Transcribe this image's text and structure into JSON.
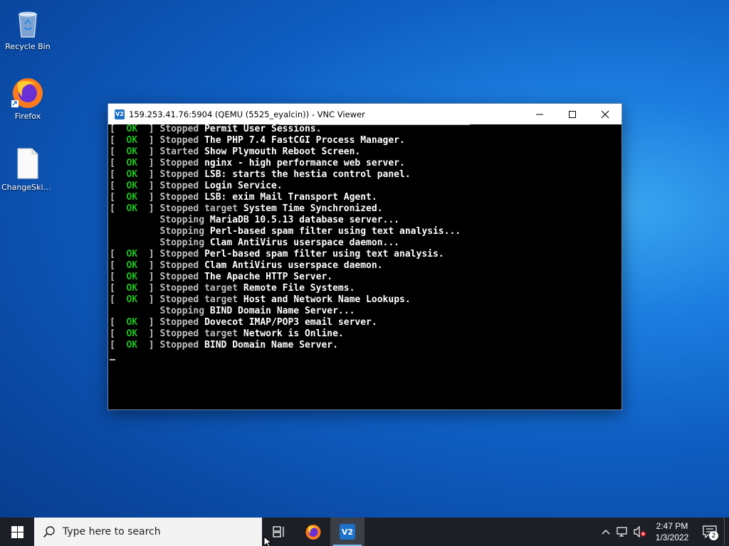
{
  "desktop": {
    "icons": [
      {
        "label": "Recycle Bin",
        "icon": "recycle-bin-icon"
      },
      {
        "label": "Firefox",
        "icon": "firefox-icon"
      },
      {
        "label": "ChangeSkin...",
        "icon": "file-icon"
      }
    ]
  },
  "window": {
    "title": "159.253.41.76:5904 (QEMU (5525_eyalcin)) - VNC Viewer",
    "logo_text": "V2"
  },
  "terminal": {
    "lines": [
      {
        "ok": true,
        "verb": "Stopped",
        "target": false,
        "text": "Permit User Sessions."
      },
      {
        "ok": true,
        "verb": "Stopped",
        "target": false,
        "text": "The PHP 7.4 FastCGI Process Manager."
      },
      {
        "ok": true,
        "verb": "Started",
        "target": false,
        "text": "Show Plymouth Reboot Screen."
      },
      {
        "ok": true,
        "verb": "Stopped",
        "target": false,
        "text": "nginx - high performance web server."
      },
      {
        "ok": true,
        "verb": "Stopped",
        "target": false,
        "text": "LSB: starts the hestia control panel."
      },
      {
        "ok": true,
        "verb": "Stopped",
        "target": false,
        "text": "Login Service."
      },
      {
        "ok": true,
        "verb": "Stopped",
        "target": false,
        "text": "LSB: exim Mail Transport Agent."
      },
      {
        "ok": true,
        "verb": "Stopped",
        "target": true,
        "text": "System Time Synchronized."
      },
      {
        "ok": false,
        "verb": "Stopping",
        "target": false,
        "text": "MariaDB 10.5.13 database server..."
      },
      {
        "ok": false,
        "verb": "Stopping",
        "target": false,
        "text": "Perl-based spam filter using text analysis..."
      },
      {
        "ok": false,
        "verb": "Stopping",
        "target": false,
        "text": "Clam AntiVirus userspace daemon..."
      },
      {
        "ok": true,
        "verb": "Stopped",
        "target": false,
        "text": "Perl-based spam filter using text analysis."
      },
      {
        "ok": true,
        "verb": "Stopped",
        "target": false,
        "text": "Clam AntiVirus userspace daemon."
      },
      {
        "ok": true,
        "verb": "Stopped",
        "target": false,
        "text": "The Apache HTTP Server."
      },
      {
        "ok": true,
        "verb": "Stopped",
        "target": true,
        "text": "Remote File Systems."
      },
      {
        "ok": true,
        "verb": "Stopped",
        "target": true,
        "text": "Host and Network Name Lookups."
      },
      {
        "ok": false,
        "verb": "Stopping",
        "target": false,
        "text": "BIND Domain Name Server..."
      },
      {
        "ok": true,
        "verb": "Stopped",
        "target": false,
        "text": "Dovecot IMAP/POP3 email server."
      },
      {
        "ok": true,
        "verb": "Stopped",
        "target": true,
        "text": "Network is Online."
      },
      {
        "ok": true,
        "verb": "Stopped",
        "target": false,
        "text": "BIND Domain Name Server."
      }
    ],
    "ok_label": "OK",
    "target_word": "target",
    "colors": {
      "ok": "#20c020",
      "verb": "#bfbfbf",
      "text": "#ffffff"
    }
  },
  "taskbar": {
    "search_placeholder": "Type here to search",
    "time": "2:47 PM",
    "date": "1/3/2022",
    "notification_count": "2"
  }
}
